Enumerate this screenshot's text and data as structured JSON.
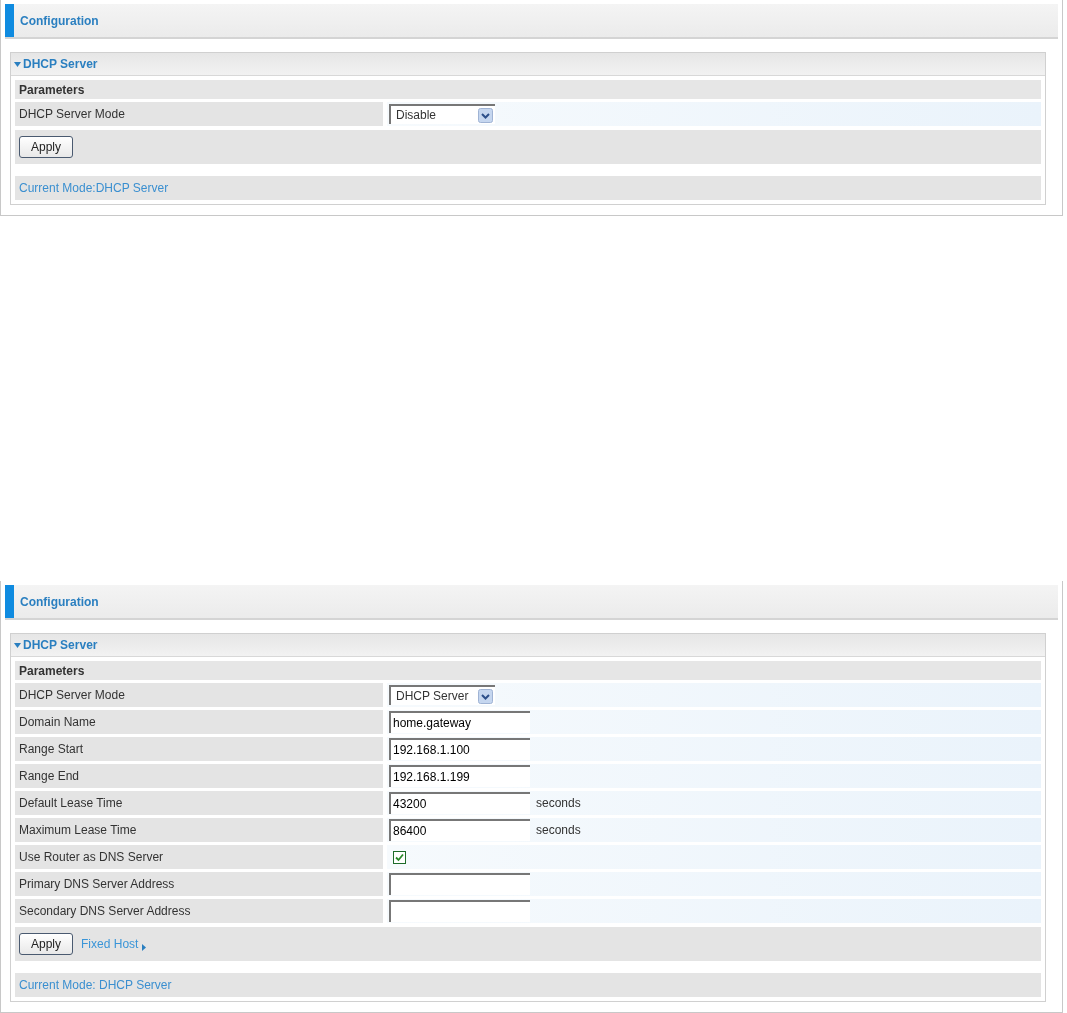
{
  "panels": [
    {
      "header": "Configuration",
      "section": "DHCP Server",
      "group": "Parameters",
      "rows": [
        {
          "kind": "select",
          "label": "DHCP Server Mode",
          "value": "Disable"
        }
      ],
      "apply": "Apply",
      "current_mode": "Current Mode:DHCP Server"
    },
    {
      "header": "Configuration",
      "section": "DHCP Server",
      "group": "Parameters",
      "rows": [
        {
          "kind": "select",
          "label": "DHCP Server Mode",
          "value": "DHCP Server"
        },
        {
          "kind": "text",
          "label": "Domain Name",
          "value": "home.gateway"
        },
        {
          "kind": "text",
          "label": "Range Start",
          "value": "192.168.1.100"
        },
        {
          "kind": "text",
          "label": "Range End",
          "value": "192.168.1.199"
        },
        {
          "kind": "text",
          "label": "Default Lease Time",
          "value": "43200",
          "unit": "seconds"
        },
        {
          "kind": "text",
          "label": "Maximum Lease Time",
          "value": "86400",
          "unit": "seconds"
        },
        {
          "kind": "checkbox",
          "label": "Use Router as DNS Server",
          "checked": true
        },
        {
          "kind": "text",
          "label": "Primary DNS Server Address",
          "value": ""
        },
        {
          "kind": "text",
          "label": "Secondary DNS Server Address",
          "value": ""
        }
      ],
      "apply": "Apply",
      "link": "Fixed Host",
      "current_mode": "Current Mode: DHCP Server"
    }
  ]
}
